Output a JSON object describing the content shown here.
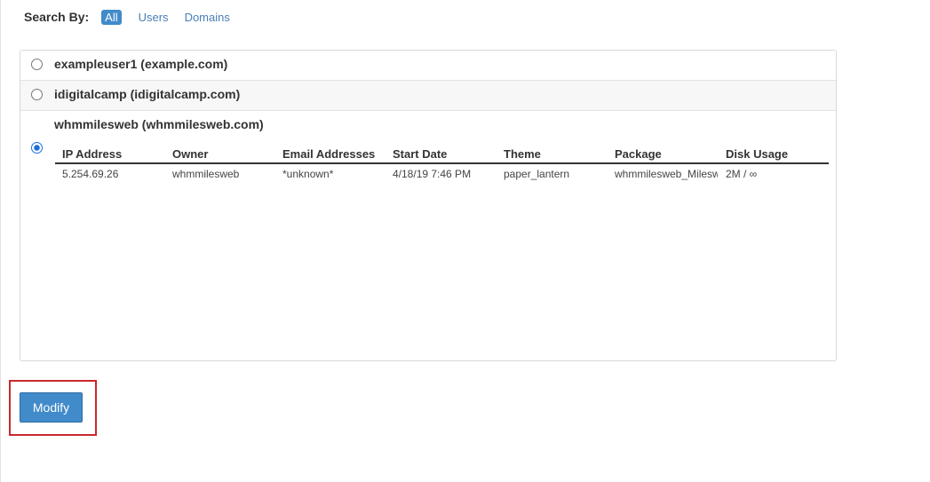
{
  "search": {
    "label": "Search By:",
    "filters": [
      "All",
      "Users",
      "Domains"
    ],
    "active_filter": "All"
  },
  "accounts": [
    {
      "label": "exampleuser1 (example.com)",
      "selected": false
    },
    {
      "label": "idigitalcamp (idigitalcamp.com)",
      "selected": false
    },
    {
      "label": "whmmilesweb (whmmilesweb.com)",
      "selected": true
    }
  ],
  "details": {
    "headers": [
      "IP Address",
      "Owner",
      "Email Addresses",
      "Start Date",
      "Theme",
      "Package",
      "Disk Usage"
    ],
    "row": [
      "5.254.69.26",
      "whmmilesweb",
      "*unknown*",
      "4/18/19 7:46 PM",
      "paper_lantern",
      "whmmilesweb_Milesweb",
      "2M / ∞"
    ]
  },
  "actions": {
    "modify_label": "Modify"
  },
  "colors": {
    "accent": "#428bca",
    "link": "#4a7fb8",
    "highlight_border": "#c9282d"
  }
}
